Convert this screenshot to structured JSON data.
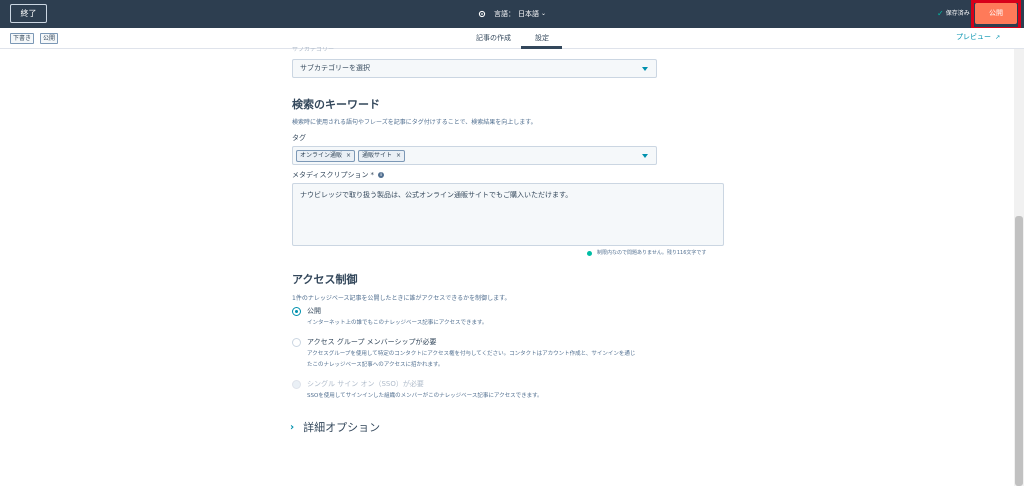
{
  "topbar": {
    "exit_label": "終了",
    "language_label": "言語：",
    "language_value": "日本語",
    "saved_label": "保存済み",
    "publish_label": "公開"
  },
  "subbar": {
    "status_chips": [
      "下書き",
      "公開"
    ],
    "tabs": [
      {
        "label": "記事の作成",
        "active": false
      },
      {
        "label": "設定",
        "active": true
      }
    ],
    "preview_label": "プレビュー"
  },
  "content": {
    "subcategory": {
      "label": "サブカテゴリー",
      "selected": "サブカテゴリーを選択"
    },
    "keywords": {
      "heading": "検索のキーワード",
      "help": "検索時に使用される語句やフレーズを記事にタグ付けすることで、検索結果を向上します。",
      "tags_label": "タグ",
      "tags": [
        "オンライン通販",
        "通販サイト"
      ]
    },
    "meta_description": {
      "label": "メタディスクリプション",
      "required_mark": "*",
      "value": "ナウビレッジで取り扱う製品は、公式オンライン通販サイトでもご購入いただけます。",
      "char_count": "制限内なので問題ありません。残り116文字です"
    },
    "access": {
      "heading": "アクセス制御",
      "help": "1件のナレッジベース記事を公開したときに誰がアクセスできるかを制御します。",
      "options": [
        {
          "title": "公開",
          "desc": [
            "インターネット上の誰でもこのナレッジベース記事にアクセスできます。"
          ],
          "checked": true,
          "disabled": false
        },
        {
          "title": "アクセス グループ メンバーシップが必要",
          "desc": [
            "アクセスグループを使用して特定のコンタクトにアクセス権を付与してください。コンタクトはアカウント作成と、サインインを通じ",
            "たこのナレッジベース記事へのアクセスに招かれます。"
          ],
          "checked": false,
          "disabled": false
        },
        {
          "title": "シングル サイン オン（SSO）が必要",
          "desc": [
            "SSOを使用してサインインした組織のメンバーがこのナレッジベース記事にアクセスできます。"
          ],
          "checked": false,
          "disabled": true
        }
      ]
    },
    "advanced": {
      "label": "詳細オプション"
    }
  },
  "colors": {
    "topbar_bg": "#2d3e50",
    "publish_bg": "#ff7a59",
    "accent": "#0091ae",
    "success": "#00bda5",
    "highlight": "#d8001a"
  }
}
